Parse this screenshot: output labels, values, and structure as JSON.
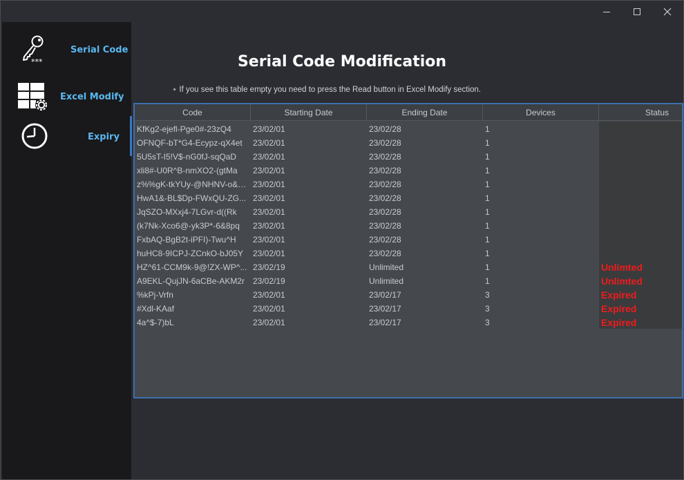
{
  "window": {
    "controls": {
      "minimize": "minimize-icon",
      "maximize": "maximize-icon",
      "close": "close-icon"
    }
  },
  "sidebar": {
    "items": [
      {
        "label": "Serial Code",
        "icon": "key-icon"
      },
      {
        "label": "Excel Modify",
        "icon": "grid-gear-icon"
      },
      {
        "label": "Expiry",
        "icon": "clock-icon"
      }
    ],
    "accent_color": "#5ab8f0"
  },
  "main": {
    "title": "Serial Code Modification",
    "notice": "⋆ If you see this table empty you need to press the Read button in Excel Modify section."
  },
  "table": {
    "columns": [
      "Code",
      "Starting Date",
      "Ending Date",
      "Devices",
      "Status"
    ],
    "rows": [
      {
        "code": "KfKg2-ejefl-Pge0#-23zQ4",
        "start": "23/02/01",
        "end": "23/02/28",
        "devices": "1",
        "status": ""
      },
      {
        "code": "OFNQF-bT*G4-Ecypz-qX4et",
        "start": "23/02/01",
        "end": "23/02/28",
        "devices": "1",
        "status": ""
      },
      {
        "code": "5U5sT-I5!V$-nG0fJ-sqQaD",
        "start": "23/02/01",
        "end": "23/02/28",
        "devices": "1",
        "status": ""
      },
      {
        "code": "xli8#-U0R^B-nmXO2-(gtMa",
        "start": "23/02/01",
        "end": "23/02/28",
        "devices": "1",
        "status": ""
      },
      {
        "code": "z%%gK-tkYUy-@NHNV-o&3...",
        "start": "23/02/01",
        "end": "23/02/28",
        "devices": "1",
        "status": ""
      },
      {
        "code": "HwA1&-BL$Dp-FWxQU-ZG...",
        "start": "23/02/01",
        "end": "23/02/28",
        "devices": "1",
        "status": ""
      },
      {
        "code": "JqSZO-MXxj4-7LGvr-d((Rk",
        "start": "23/02/01",
        "end": "23/02/28",
        "devices": "1",
        "status": ""
      },
      {
        "code": "(k7Nk-Xco6@-yk3P*-6&8pq",
        "start": "23/02/01",
        "end": "23/02/28",
        "devices": "1",
        "status": ""
      },
      {
        "code": "FxbAQ-BgB2t-iPFI)-Twu^H",
        "start": "23/02/01",
        "end": "23/02/28",
        "devices": "1",
        "status": ""
      },
      {
        "code": "huHC8-9ICPJ-ZCnkO-bJ05Y",
        "start": "23/02/01",
        "end": "23/02/28",
        "devices": "1",
        "status": ""
      },
      {
        "code": "HZ^61-CCM9k-9@!ZX-WP^...",
        "start": "23/02/19",
        "end": "Unlimited",
        "devices": "1",
        "status": "Unlimted"
      },
      {
        "code": "A9EKL-QujJN-6aCBe-AKM2r",
        "start": "23/02/19",
        "end": "Unlimited",
        "devices": "1",
        "status": "Unlimted"
      },
      {
        "code": "%kPj-Vrfn",
        "start": "23/02/01",
        "end": "23/02/17",
        "devices": "3",
        "status": "Expired"
      },
      {
        "code": "#Xdl-KAaf",
        "start": "23/02/01",
        "end": "23/02/17",
        "devices": "3",
        "status": "Expired"
      },
      {
        "code": "4a^$-7)bL",
        "start": "23/02/01",
        "end": "23/02/17",
        "devices": "3",
        "status": "Expired"
      }
    ],
    "status_color": "#ee1c1c",
    "header_border_color": "#3d6fae"
  }
}
